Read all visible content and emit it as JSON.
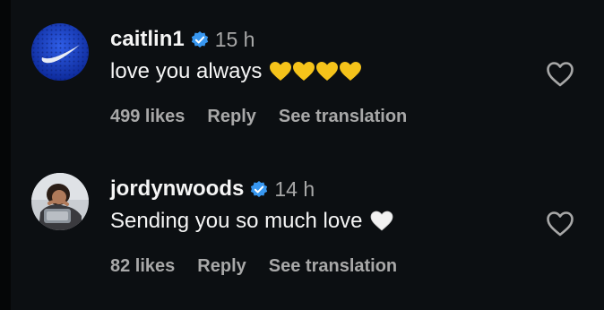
{
  "comments": [
    {
      "username": "caitlin1",
      "time": "15 h",
      "text": "love you always",
      "emoji": "yellow-heart x4",
      "likes": "499 likes",
      "reply": "Reply",
      "translate": "See translation",
      "avatar_icon": "nike-avatar",
      "accent": "#f5c31a"
    },
    {
      "username": "jordynwoods",
      "time": "14 h",
      "text": "Sending you so much love",
      "emoji": "white-heart",
      "likes": "82 likes",
      "reply": "Reply",
      "translate": "See translation",
      "avatar_icon": "profile-photo",
      "accent": "#f2f2f2"
    }
  ],
  "colors": {
    "background": "#0c0f12",
    "primary_text": "#f5f5f5",
    "secondary_text": "#a8a8a8",
    "verified_blue": "#3897f0"
  }
}
